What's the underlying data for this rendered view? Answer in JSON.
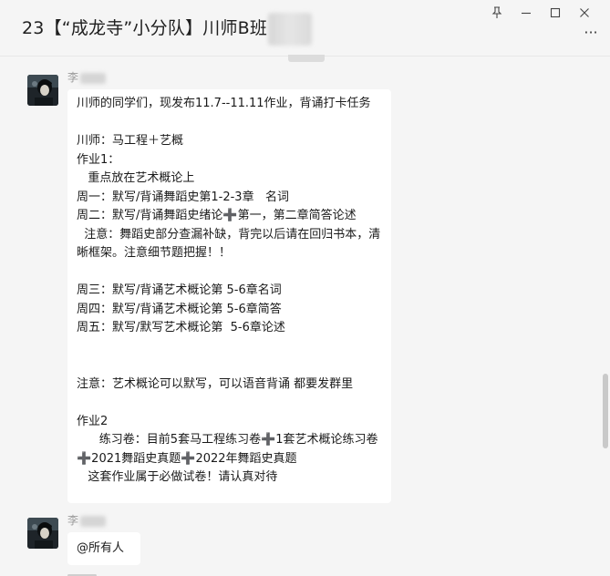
{
  "window": {
    "title": "23【“成龙寺”小分队】川师B班",
    "controls": {
      "pin_icon": "pin-icon",
      "pin_glyph": "⩟",
      "minimize_glyph": "—",
      "maximize_glyph": "☐",
      "close_glyph": "✕",
      "more_glyph": "···"
    }
  },
  "messages": [
    {
      "sender": "李",
      "text": "川师的同学们，现发布11.7--11.11作业，背诵打卡任务\n\n川师：马工程＋艺概\n作业1：\n   重点放在艺术概论上\n周一：默写/背诵舞蹈史第1-2-3章   名词\n周二：默写/背诵舞蹈史绪论➕第一，第二章简答论述\n  注意：舞蹈史部分查漏补缺，背完以后请在回归书本，清晰框架。注意细节题把握！！\n\n周三：默写/背诵艺术概论第 5-6章名词\n周四：默写/背诵艺术概论第 5-6章简答\n周五：默写/默写艺术概论第  5-6章论述\n\n\n注意：艺术概论可以默写，可以语音背诵 都要发群里\n\n作业2\n      练习卷：目前5套马工程练习卷➕1套艺术概论练习卷➕2021舞蹈史真题➕2022年舞蹈史真题\n   这套作业属于必做试卷！请认真对待"
    },
    {
      "sender": "李",
      "text": "@所有人"
    }
  ],
  "colors": {
    "window_bg": "#f5f5f5",
    "bubble_bg": "#ffffff",
    "sender_text": "#9a9a9a",
    "text": "#1a1a1a"
  }
}
